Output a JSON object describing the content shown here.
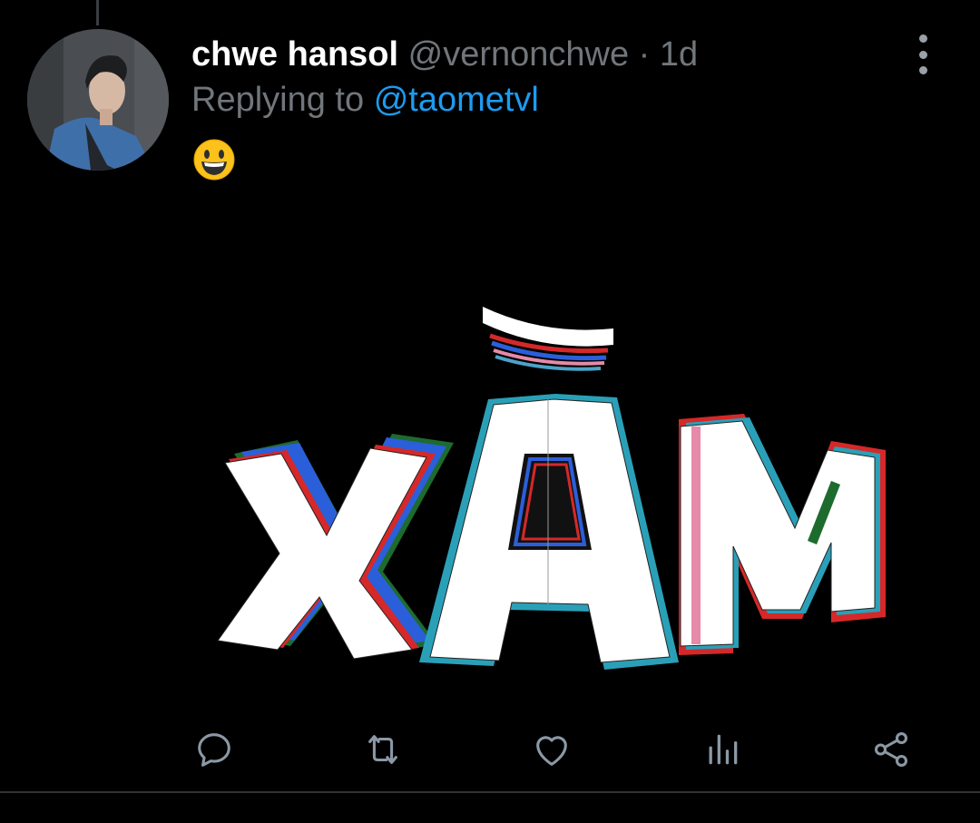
{
  "tweet": {
    "display_name": "chwe hansol",
    "handle": "@vernonchwe",
    "separator": "·",
    "timestamp": "1d",
    "replying_prefix": "Replying to",
    "replying_to": "@taometvl",
    "emoji": "grinning-face"
  },
  "media": {
    "text": "XĂM"
  },
  "actions": [
    {
      "name": "reply",
      "icon": "reply-icon"
    },
    {
      "name": "retweet",
      "icon": "retweet-icon"
    },
    {
      "name": "like",
      "icon": "heart-icon"
    },
    {
      "name": "views",
      "icon": "analytics-icon"
    },
    {
      "name": "share",
      "icon": "share-icon"
    }
  ],
  "colors": {
    "background": "#000000",
    "name": "#ffffff",
    "muted": "#71767b",
    "link": "#1d9bf0",
    "icon": "#8b98a5"
  }
}
